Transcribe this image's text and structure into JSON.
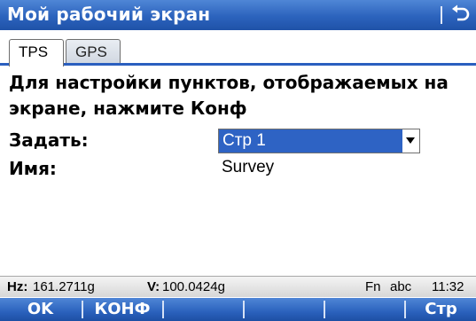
{
  "window": {
    "title": "Мой рабочий экран",
    "back_icon": "return-arrow-icon"
  },
  "tabs": [
    {
      "label": "TPS",
      "active": true
    },
    {
      "label": "GPS",
      "active": false
    }
  ],
  "content": {
    "instruction": "Для настройки пунктов, отображаемых на экране, нажмите Конф",
    "fields": {
      "set_label": "Задать:",
      "set_value": "Стр 1",
      "name_label": "Имя:",
      "name_value": "Survey"
    }
  },
  "statusbar": {
    "hz_label": "Hz:",
    "hz_value": "161.2711g",
    "v_label": "V:",
    "v_value": "100.0424g",
    "fn": "Fn",
    "input_mode": "abc",
    "time": "11:32"
  },
  "softkeys": {
    "ok": "OK",
    "config": "КОНФ",
    "page": "Стр"
  },
  "colors": {
    "titlebar": "#2c63bd",
    "selection": "#2e63c4"
  }
}
